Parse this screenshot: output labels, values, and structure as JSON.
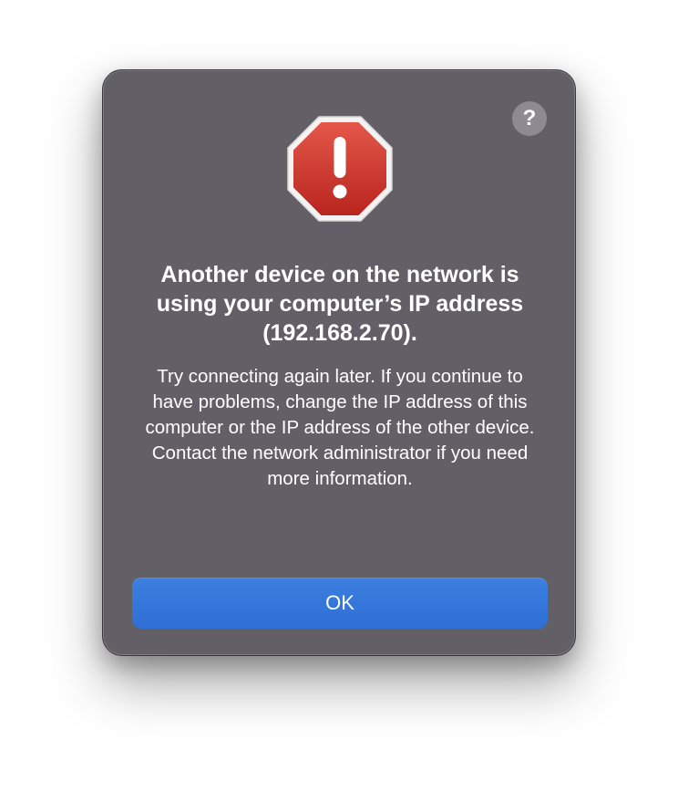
{
  "dialog": {
    "help_label": "?",
    "icon": "stop-sign-exclamation-icon",
    "title": "Another device on the network is using your computer’s IP address (192.168.2.70).",
    "message": "Try connecting again later. If you continue to have problems, change the IP address of this computer or the IP address of the other device. Contact the network administrator if you need more information.",
    "ok_label": "OK"
  },
  "colors": {
    "dialog_bg": "#625f66",
    "icon_red": "#d0352b",
    "button_blue": "#3575dd",
    "help_bg": "#8d8a91"
  }
}
